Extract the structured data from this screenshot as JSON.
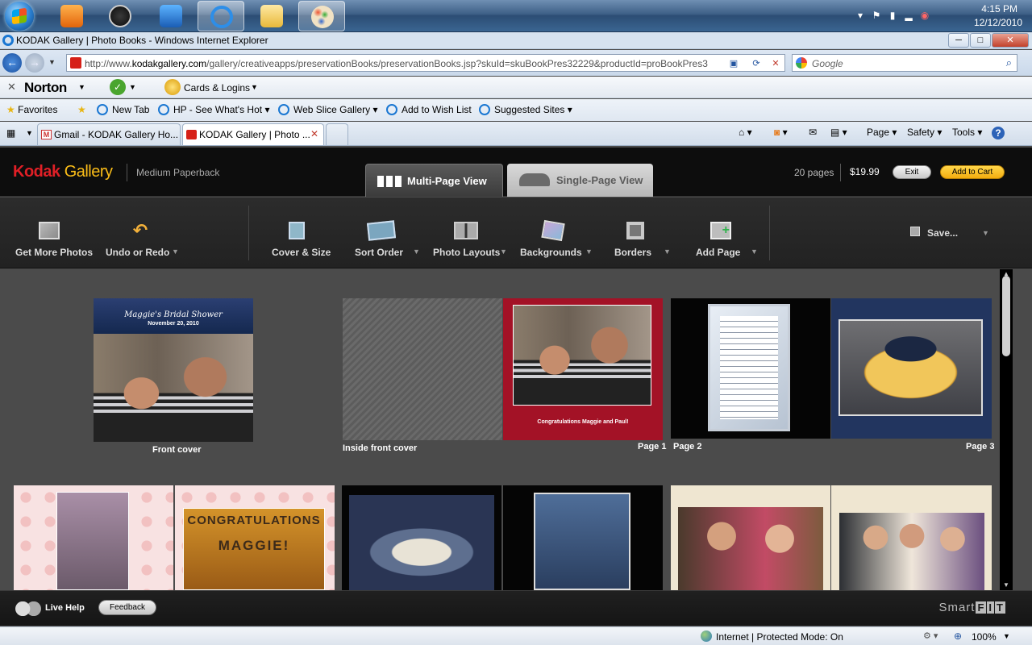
{
  "taskbar": {
    "time": "4:15 PM",
    "date": "12/12/2010"
  },
  "window": {
    "title": "KODAK Gallery | Photo Books - Windows Internet Explorer",
    "controls": {
      "minimize": "─",
      "maximize": "□",
      "close": "✕"
    }
  },
  "address": {
    "url_prefix": "http://www.",
    "url_domain": "kodakgallery.com",
    "url_path": "/gallery/creativeapps/preservationBooks/preservationBooks.jsp?skuId=skuBookPres32229&productId=proBookPres3",
    "search_placeholder": "Google"
  },
  "norton": {
    "brand": "Norton",
    "cards_label": "Cards & Logins"
  },
  "favorites": {
    "label": "Favorites",
    "items": [
      "New Tab",
      "HP - See What's Hot",
      "Web Slice Gallery",
      "Add to Wish List",
      "Suggested Sites"
    ]
  },
  "tabs": [
    {
      "label": "Gmail - KODAK Gallery Ho..."
    },
    {
      "label": "KODAK Gallery | Photo ..."
    }
  ],
  "commands": {
    "page": "Page",
    "safety": "Safety",
    "tools": "Tools",
    "help": "?"
  },
  "app": {
    "logo_main": "Kodak",
    "logo_sub": "Gallery",
    "product": "Medium Paperback",
    "view_multi": "Multi-Page View",
    "view_single": "Single-Page View",
    "pages_count": "20 pages",
    "price": "$19.99",
    "exit": "Exit",
    "add_to_cart": "Add to Cart"
  },
  "toolbar": {
    "get_photos": "Get More Photos",
    "undo": "Undo or Redo",
    "cover": "Cover & Size",
    "sort": "Sort Order",
    "layouts": "Photo Layouts",
    "backgrounds": "Backgrounds",
    "borders": "Borders",
    "add_page": "Add Page",
    "save": "Save..."
  },
  "book": {
    "cover_title": "Maggie's Bridal Shower",
    "cover_date": "November 20, 2010",
    "page1_caption": "Congratulations Maggie and Paul!",
    "banner_line1": "CONGRATULATIONS",
    "banner_line2": "MAGGIE!",
    "labels": {
      "front_cover": "Front cover",
      "inside_front": "Inside front cover",
      "page1": "Page 1",
      "page2": "Page 2",
      "page3": "Page 3"
    }
  },
  "bottom": {
    "live_help": "Live Help",
    "feedback": "Feedback",
    "smartfit_word": "Smart",
    "smartfit_letters": [
      "F",
      "I",
      "T"
    ]
  },
  "status": {
    "zone": "Internet | Protected Mode: On",
    "zoom": "100%"
  },
  "colors": {
    "kodak_red": "#e01f26",
    "kodak_yellow": "#fbbd18",
    "canvas_bg": "#4b4b4b"
  }
}
